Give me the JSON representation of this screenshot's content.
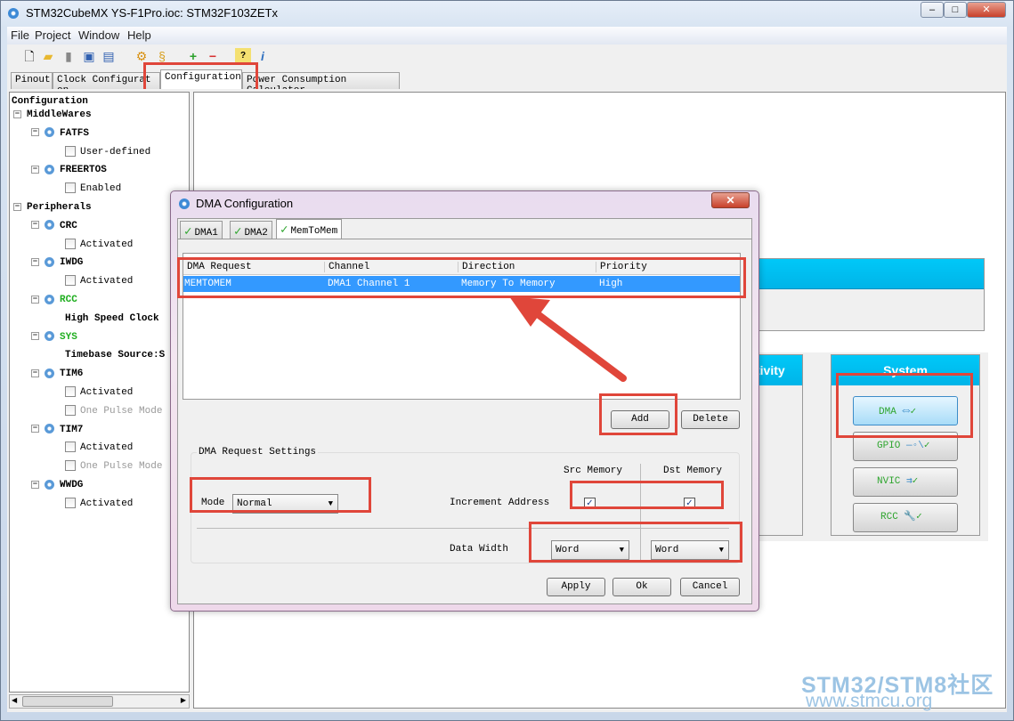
{
  "window": {
    "title": "STM32CubeMX YS-F1Pro.ioc: STM32F103ZETx",
    "controls": [
      "minimize",
      "maximize",
      "close"
    ]
  },
  "menu": [
    "File",
    "Project",
    "Window",
    "Help"
  ],
  "toolbar": {
    "icons": [
      "new-project-icon",
      "open-folder-icon",
      "copy-icon",
      "save-icon",
      "save-as-icon",
      "generate-icon",
      "report-icon",
      "zoom-in-icon",
      "zoom-out-icon",
      "help-icon",
      "about-icon"
    ]
  },
  "tabs": [
    {
      "label": "Pinout"
    },
    {
      "label": "Clock Configurat on"
    },
    {
      "label": "Configuration",
      "active": true
    },
    {
      "label": "Power Consumption Calculator"
    }
  ],
  "tree": [
    {
      "label": "Configuration",
      "kind": "root"
    },
    {
      "label": "MiddleWares",
      "kind": "group"
    },
    {
      "label": "FATFS",
      "kind": "node"
    },
    {
      "label": "User-defined",
      "kind": "check"
    },
    {
      "label": "FREERTOS",
      "kind": "node"
    },
    {
      "label": "Enabled",
      "kind": "check"
    },
    {
      "label": "Peripherals",
      "kind": "group"
    },
    {
      "label": "CRC",
      "kind": "node"
    },
    {
      "label": "Activated",
      "kind": "check"
    },
    {
      "label": "IWDG",
      "kind": "node"
    },
    {
      "label": "Activated",
      "kind": "check"
    },
    {
      "label": "RCC",
      "kind": "node",
      "color": "#1fae1f"
    },
    {
      "label": "High Speed Clock",
      "kind": "text"
    },
    {
      "label": "SYS",
      "kind": "node",
      "color": "#1fae1f"
    },
    {
      "label": "Timebase Source:S",
      "kind": "text"
    },
    {
      "label": "TIM6",
      "kind": "node"
    },
    {
      "label": "Activated",
      "kind": "check"
    },
    {
      "label": "One Pulse Mode",
      "kind": "check",
      "disabled": true
    },
    {
      "label": "TIM7",
      "kind": "node"
    },
    {
      "label": "Activated",
      "kind": "check"
    },
    {
      "label": "One Pulse Mode",
      "kind": "check",
      "disabled": true
    },
    {
      "label": "WWDG",
      "kind": "node"
    },
    {
      "label": "Activated",
      "kind": "check"
    }
  ],
  "main": {
    "connectivity_header": "tivity",
    "system_header": "System",
    "system_buttons": [
      "DMA",
      "GPIO",
      "NVIC",
      "RCC"
    ]
  },
  "dialog": {
    "title": "DMA Configuration",
    "tabs": [
      "DMA1",
      "DMA2",
      "MemToMem"
    ],
    "table": {
      "headers": [
        "DMA Request",
        "Channel",
        "Direction",
        "Priority"
      ],
      "rows": [
        [
          "MEMTOMEM",
          "DMA1 Channel 1",
          "Memory To Memory",
          "High"
        ]
      ]
    },
    "add": "Add",
    "delete": "Delete",
    "settings": {
      "title": "DMA Request Settings",
      "src_label": "Src Memory",
      "dst_label": "Dst Memory",
      "mode_label": "Mode",
      "mode_value": "Normal",
      "increment_label": "Increment Address",
      "src_increment": true,
      "dst_increment": true,
      "width_label": "Data Width",
      "src_width": "Word",
      "dst_width": "Word"
    },
    "apply": "Apply",
    "ok": "Ok",
    "cancel": "Cancel",
    "checked_mark": "✓"
  },
  "watermark": {
    "line1": "STM32/STM8社区",
    "line2": "www.stmcu.org"
  },
  "colors": {
    "highlight": "#e0463a",
    "selection": "#3399ff",
    "header_cyan": "#00c0f0"
  }
}
